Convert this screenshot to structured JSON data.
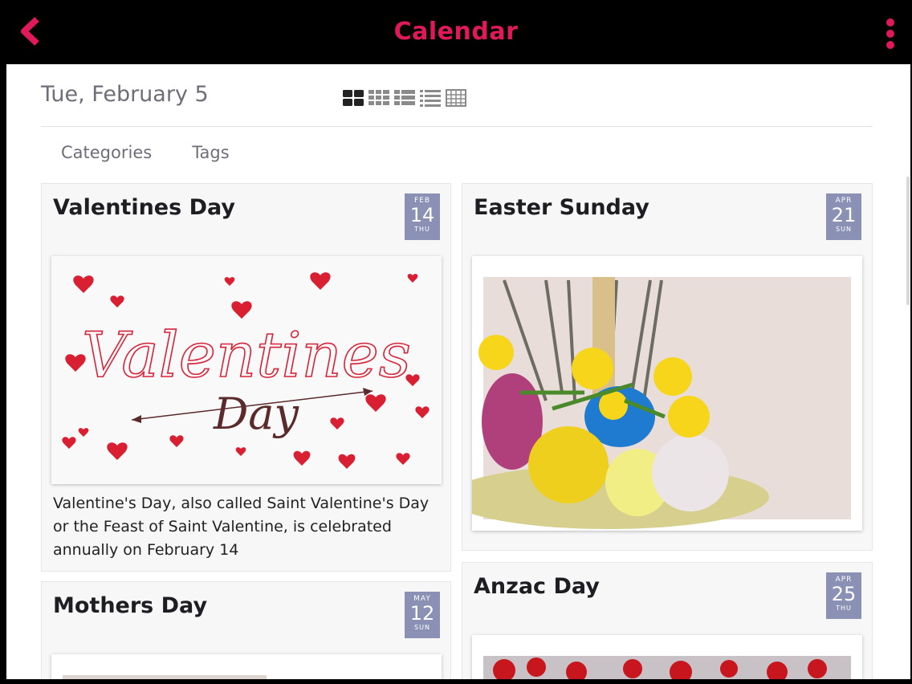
{
  "header": {
    "title": "Calendar",
    "back_icon": "chevron-left-icon",
    "menu_icon": "kebab-menu-icon",
    "accent": "#e0195a"
  },
  "date_heading": "Tue, February 5",
  "view_modes": [
    "grid-large-icon",
    "grid-small-icon",
    "list-thumb-icon",
    "list-icon",
    "month-grid-icon"
  ],
  "filter_tabs": [
    "Categories",
    "Tags"
  ],
  "events": [
    {
      "title": "Valentines Day",
      "badge": {
        "month": "FEB",
        "day": "14",
        "weekday": "THU"
      },
      "description": "Valentine's Day, also called Saint Valentine's Day or the Feast of Saint Valentine, is celebrated annually on February 14"
    },
    {
      "title": "Easter Sunday",
      "badge": {
        "month": "APR",
        "day": "21",
        "weekday": "SUN"
      }
    },
    {
      "title": "Mothers Day",
      "badge": {
        "month": "MAY",
        "day": "12",
        "weekday": "SUN"
      }
    },
    {
      "title": "Anzac Day",
      "badge": {
        "month": "APR",
        "day": "25",
        "weekday": "THU"
      }
    }
  ],
  "image_art": {
    "valentine_script_1": "Valentines",
    "valentine_script_2": "Day"
  },
  "badge_color": "#8b91b4"
}
